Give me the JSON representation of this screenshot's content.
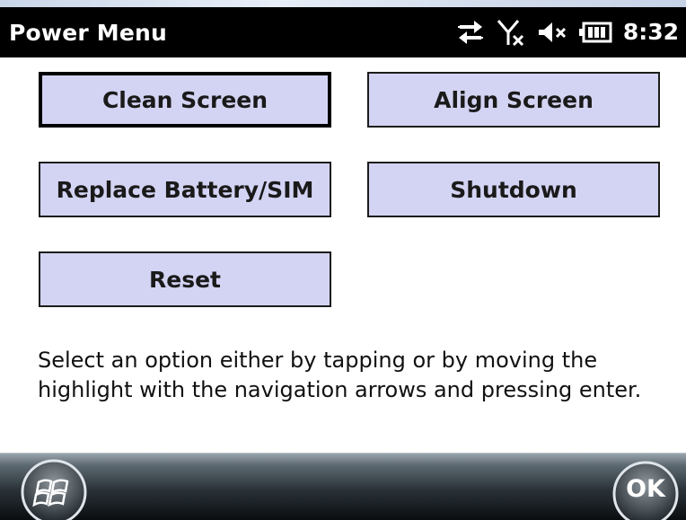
{
  "titlebar": {
    "title": "Power Menu",
    "clock": "8:32",
    "icons": [
      "sync-arrows-icon",
      "no-signal-icon",
      "speaker-muted-icon",
      "battery-icon"
    ]
  },
  "menu": {
    "buttons": [
      {
        "label": "Clean Screen",
        "selected": true
      },
      {
        "label": "Align Screen",
        "selected": false
      },
      {
        "label": "Replace Battery/SIM",
        "selected": false
      },
      {
        "label": "Shutdown",
        "selected": false
      },
      {
        "label": "Reset",
        "selected": false
      }
    ]
  },
  "instructions": "Select an option either by tapping or by moving the highlight with the navigation arrows and pressing enter.",
  "softkeys": {
    "start_icon": "windows-flag-icon",
    "ok_label": "OK"
  },
  "colors": {
    "button_fill": "#d3d3f3",
    "button_border": "#1c1c1c",
    "titlebar_bg": "#000000",
    "text": "#111111"
  }
}
